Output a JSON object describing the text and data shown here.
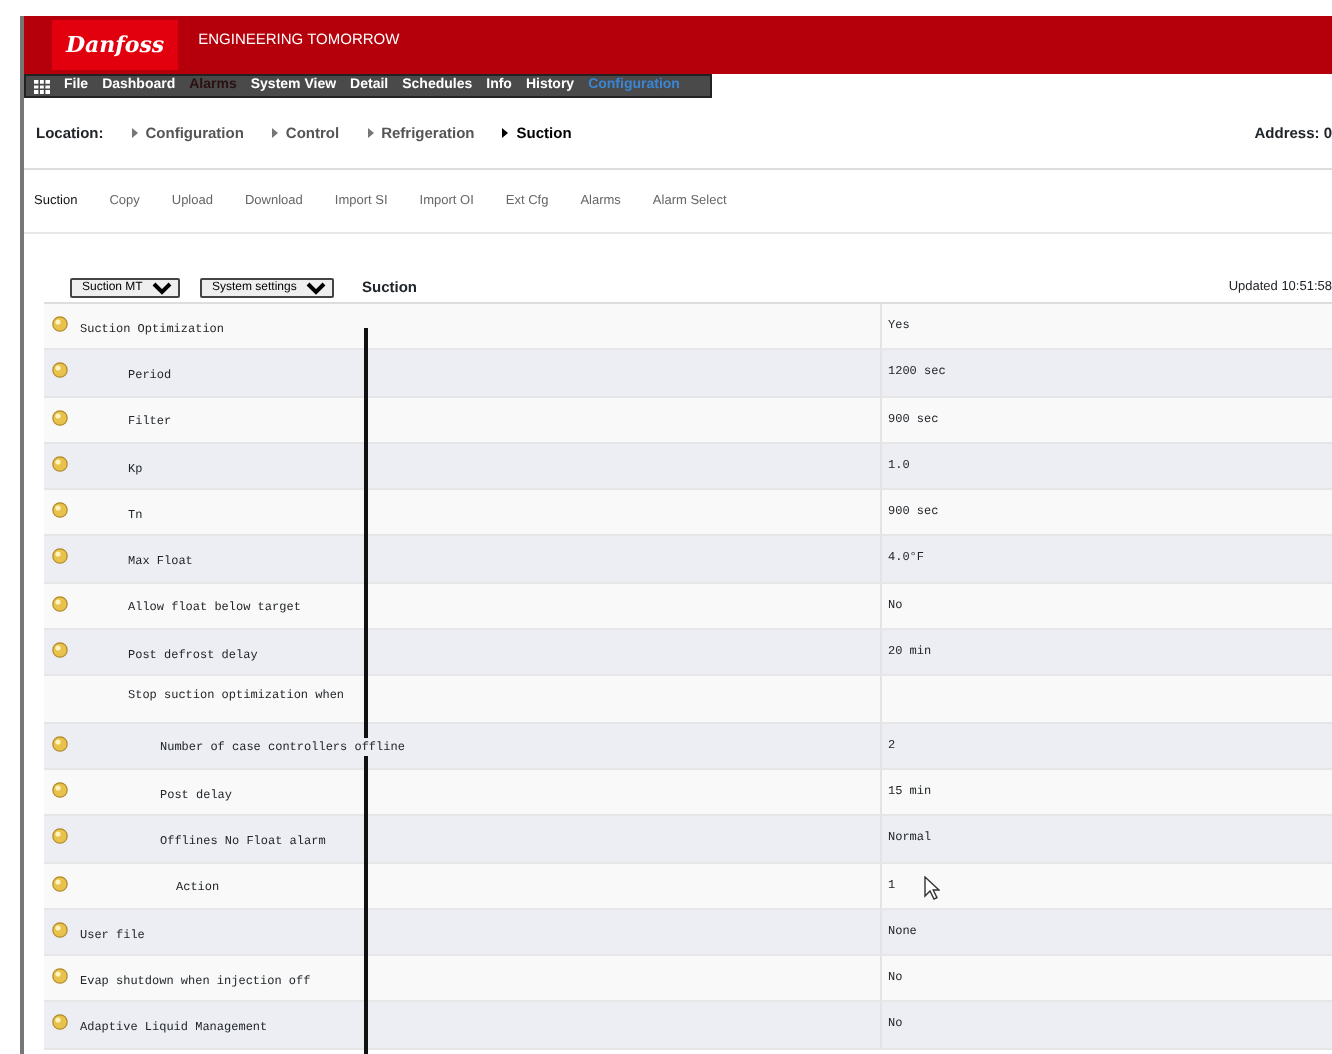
{
  "header": {
    "logo": "Danfoss",
    "tagline": "ENGINEERING TOMORROW"
  },
  "menu": [
    {
      "label": "File",
      "kind": "normal",
      "selected": false
    },
    {
      "label": "Dashboard",
      "kind": "normal",
      "selected": false
    },
    {
      "label": "Alarms",
      "kind": "alarm",
      "selected": false
    },
    {
      "label": "System View",
      "kind": "normal",
      "selected": false
    },
    {
      "label": "Detail",
      "kind": "normal",
      "selected": false
    },
    {
      "label": "Schedules",
      "kind": "normal",
      "selected": false
    },
    {
      "label": "Info",
      "kind": "normal",
      "selected": false
    },
    {
      "label": "History",
      "kind": "normal",
      "selected": false
    },
    {
      "label": "Configuration",
      "kind": "normal",
      "selected": true
    }
  ],
  "location": {
    "label": "Location:",
    "crumbs": [
      {
        "label": "Configuration",
        "selected": false
      },
      {
        "label": "Control",
        "selected": false
      },
      {
        "label": "Refrigeration",
        "selected": false
      },
      {
        "label": "Suction",
        "selected": true
      }
    ],
    "address": "Address: 0"
  },
  "tabs": [
    {
      "label": "Suction",
      "selected": true
    },
    {
      "label": "Copy",
      "selected": false
    },
    {
      "label": "Upload",
      "selected": false
    },
    {
      "label": "Download",
      "selected": false
    },
    {
      "label": "Import SI",
      "selected": false
    },
    {
      "label": "Import OI",
      "selected": false
    },
    {
      "label": "Ext Cfg",
      "selected": false
    },
    {
      "label": "Alarms",
      "selected": false
    },
    {
      "label": "Alarm Select",
      "selected": false
    }
  ],
  "toolbar": {
    "selects": [
      "Suction MT",
      "System settings"
    ],
    "title": "Suction",
    "updated": "Updated 10:51:58"
  },
  "rows": [
    {
      "kind": "setting",
      "label": "Suction Optimization",
      "value": "Yes",
      "children": [
        {
          "kind": "setting",
          "label": "Period",
          "value": "1200 sec"
        },
        {
          "kind": "setting",
          "label": "Filter",
          "value": "900 sec"
        },
        {
          "kind": "setting",
          "label": "Kp",
          "value": "1.0"
        },
        {
          "kind": "setting",
          "label": "Tn",
          "value": "900 sec"
        },
        {
          "kind": "setting",
          "label": "Max Float",
          "value": "4.0°F"
        },
        {
          "kind": "setting",
          "label": "Allow float below target",
          "value": "No"
        },
        {
          "kind": "setting",
          "label": "Post defrost delay",
          "value": "20 min"
        },
        {
          "kind": "heading",
          "label": "Stop suction optimization when",
          "children": [
            {
              "kind": "setting",
              "label": "Number of case controllers offline",
              "value": "2"
            },
            {
              "kind": "setting",
              "label": "Post delay",
              "value": "15 min"
            },
            {
              "kind": "setting",
              "label": "Offlines No Float alarm",
              "value": "Normal",
              "children": [
                {
                  "kind": "setting",
                  "label": "Action",
                  "value": "1"
                }
              ]
            }
          ]
        }
      ]
    },
    {
      "kind": "setting",
      "label": "User file",
      "value": "None"
    },
    {
      "kind": "setting",
      "label": "Evap shutdown when injection off",
      "value": "No"
    },
    {
      "kind": "setting",
      "label": "Adaptive Liquid Management",
      "value": "No"
    }
  ]
}
